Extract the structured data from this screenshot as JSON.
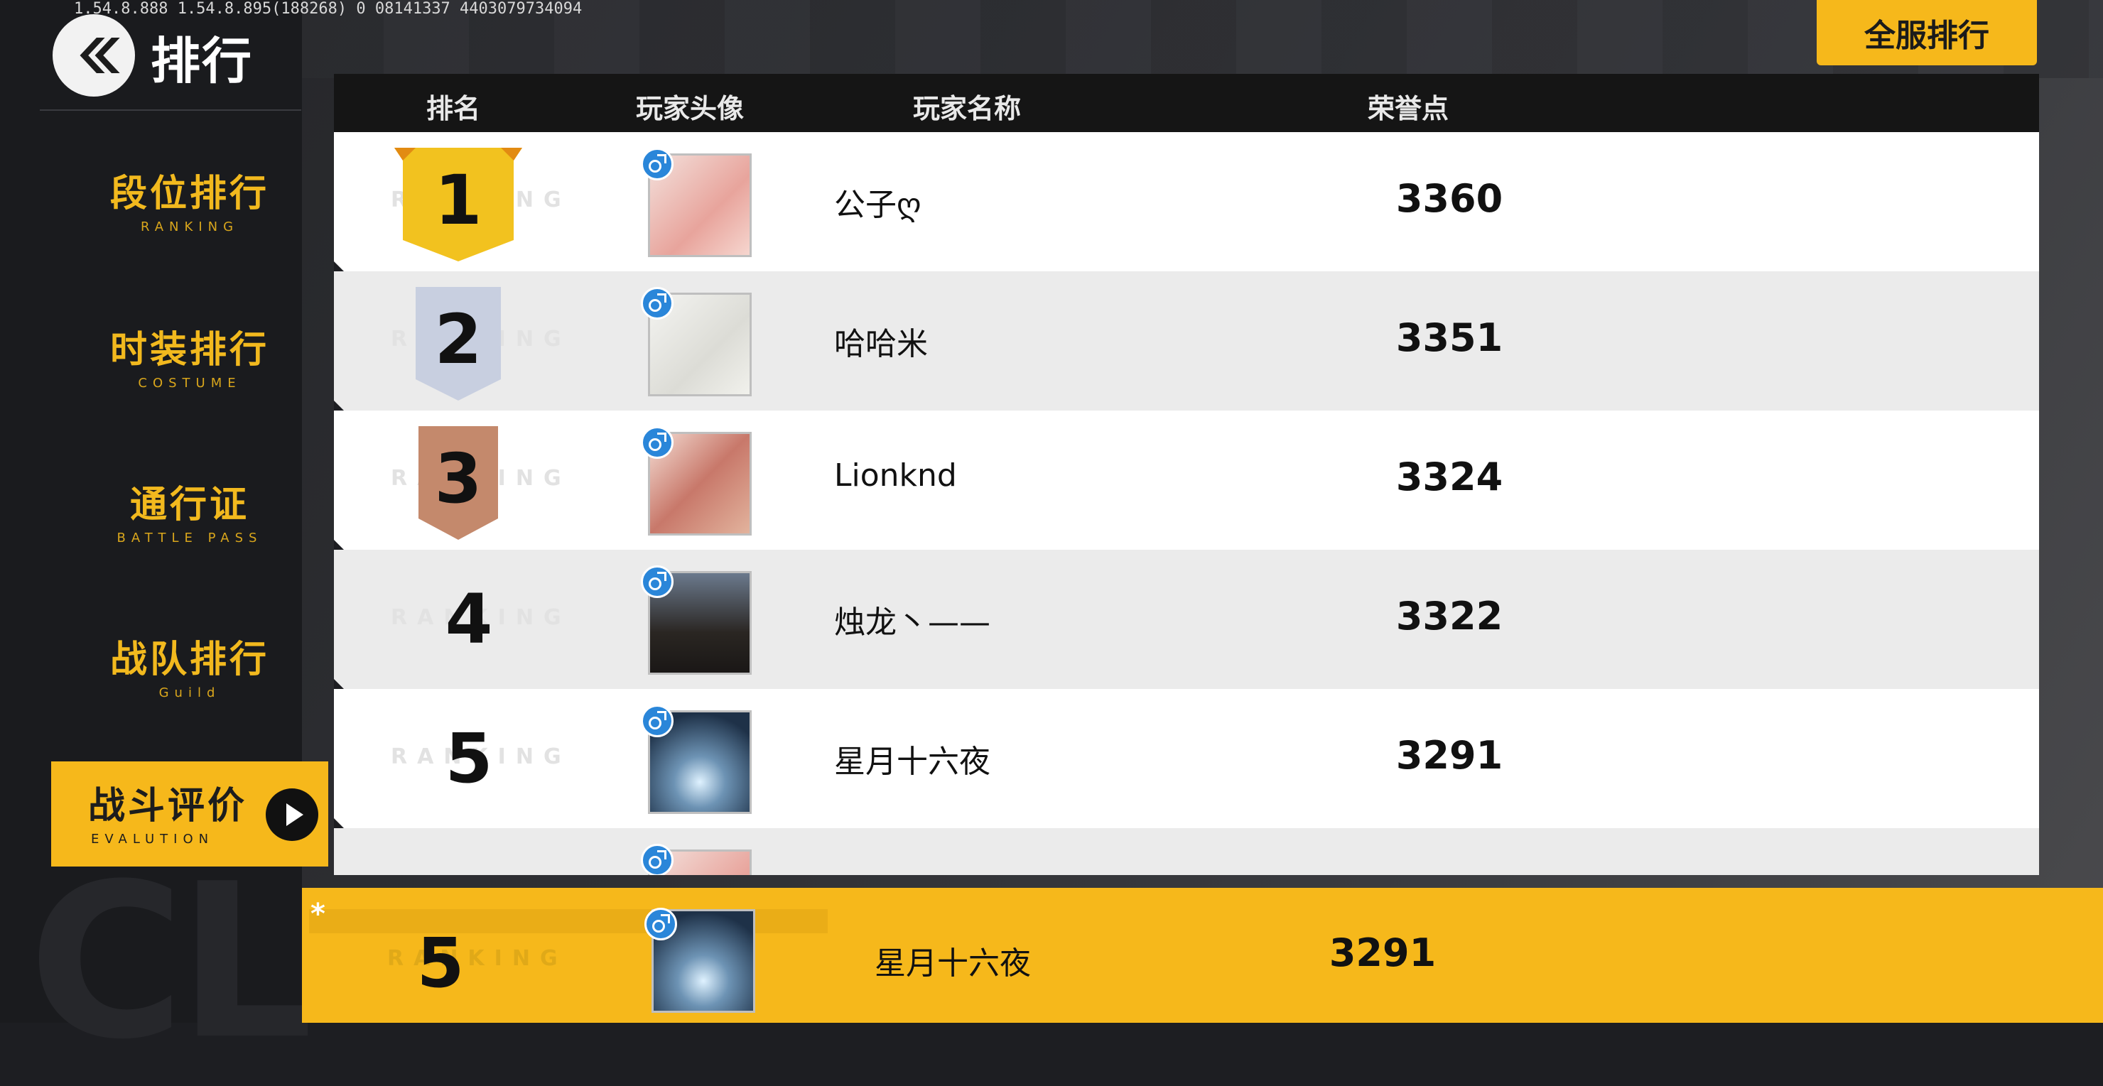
{
  "version_text": "1.54.8.888  1.54.8.895(188268)  0  08141337  4403079734094",
  "header": {
    "title": "排行",
    "server_button_label": "全服排行"
  },
  "nav": [
    {
      "cn": "段位排行",
      "en": "RANKING"
    },
    {
      "cn": "时装排行",
      "en": "COSTUME"
    },
    {
      "cn": "通行证",
      "en": "BATTLE PASS"
    },
    {
      "cn": "战队排行",
      "en": "Guild"
    },
    {
      "cn": "战斗评价",
      "en": "EVALUTION"
    }
  ],
  "table": {
    "columns": [
      "排名",
      "玩家头像",
      "玩家名称",
      "荣誉点"
    ],
    "ghost_text": "RANKING",
    "rows": [
      {
        "rank": "1",
        "name": "公子ღ",
        "points": "3360",
        "medal": "gold",
        "gender_icon": "male-icon"
      },
      {
        "rank": "2",
        "name": "哈哈米",
        "points": "3351",
        "medal": "silver",
        "gender_icon": "male-icon"
      },
      {
        "rank": "3",
        "name": "Lionknd",
        "points": "3324",
        "medal": "bronze",
        "gender_icon": "male-icon"
      },
      {
        "rank": "4",
        "name": "烛龙丶——",
        "points": "3322",
        "medal": "",
        "gender_icon": "male-icon"
      },
      {
        "rank": "5",
        "name": "星月十六夜",
        "points": "3291",
        "medal": "",
        "gender_icon": "male-icon"
      }
    ]
  },
  "self_row": {
    "marker": "*",
    "rank": "5",
    "name": "星月十六夜",
    "points": "3291",
    "ghost_text": "RANKING"
  },
  "colors": {
    "accent": "#f6b81b",
    "gold": "#f2c21f",
    "silver": "#c8cfe0",
    "bronze": "#c4896c"
  }
}
